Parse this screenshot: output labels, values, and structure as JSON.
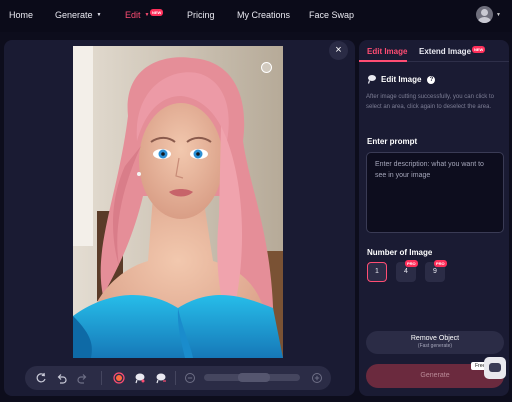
{
  "nav": {
    "items": [
      {
        "label": "Home"
      },
      {
        "label": "Generate"
      },
      {
        "label": "Edit",
        "badge": "NEW",
        "active": true
      },
      {
        "label": "Pricing"
      },
      {
        "label": "My Creations"
      },
      {
        "label": "Face Swap"
      }
    ]
  },
  "editor": {
    "close_glyph": "×"
  },
  "toolbar": {
    "icons": [
      "rotate-icon",
      "undo-icon",
      "redo-icon",
      "brush-icon",
      "lasso-icon",
      "lasso-remove-icon",
      "zoom-out-icon",
      "zoom-in-icon"
    ]
  },
  "panel": {
    "tabs": [
      {
        "label": "Edit Image",
        "active": true
      },
      {
        "label": "Extend Image",
        "badge": "NEW"
      }
    ],
    "edit_title": "Edit Image",
    "help_glyph": "?",
    "description": "After image cutting successfully, you can click to select an area, click again to deselect the area.",
    "prompt_title": "Enter prompt",
    "prompt_placeholder": "Enter description: what you want to see in your image",
    "number_title": "Number of Image",
    "numbers": [
      {
        "value": "1",
        "selected": true
      },
      {
        "value": "4",
        "badge": "PRO"
      },
      {
        "value": "9",
        "badge": "PRO"
      }
    ],
    "remove_label": "Remove Object",
    "remove_sub": "(Fast generate)",
    "generate_label": "Generate"
  },
  "chat": {
    "free_label": "Free"
  },
  "colors": {
    "accent": "#ff4d73",
    "background": "#0d0d1c",
    "panel": "#1a1b33"
  }
}
